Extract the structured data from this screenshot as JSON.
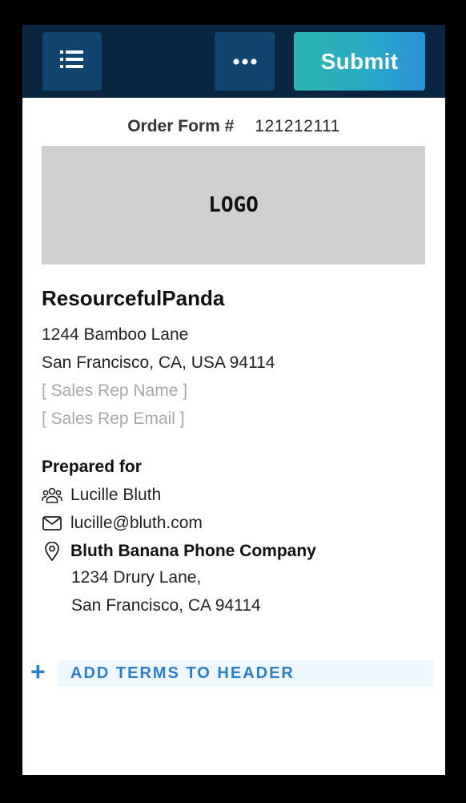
{
  "toolbar": {
    "menu_icon": "list-icon",
    "more_icon": "more-dots-icon",
    "submit_label": "Submit"
  },
  "order": {
    "label": "Order Form #",
    "number": "121212111"
  },
  "logo": {
    "text": "LOGO"
  },
  "seller": {
    "name": "ResourcefulPanda",
    "address_line1": "1244 Bamboo Lane",
    "address_line2": "San Francisco, CA, USA 94114",
    "sales_rep_name": "[ Sales Rep Name ]",
    "sales_rep_email": "[ Sales Rep Email ]"
  },
  "prepared_for": {
    "heading": "Prepared for",
    "contact_name": "Lucille Bluth",
    "email": "lucille@bluth.com",
    "company": "Bluth Banana Phone Company",
    "address_line1": "1234 Drury Lane,",
    "address_line2": "San Francisco, CA 94114",
    "icons": [
      "users-icon",
      "mail-icon",
      "location-pin-icon"
    ]
  },
  "terms": {
    "add_label": "ADD TERMS TO HEADER",
    "plus_symbol": "+"
  },
  "colors": {
    "topbar": "#0a2540",
    "toolbar_button": "#11456f",
    "submit_gradient_start": "#2ab5ae",
    "submit_gradient_end": "#2c8fd8",
    "accent_link": "#2a7fc8",
    "logo_placeholder": "#d0d0d0"
  }
}
